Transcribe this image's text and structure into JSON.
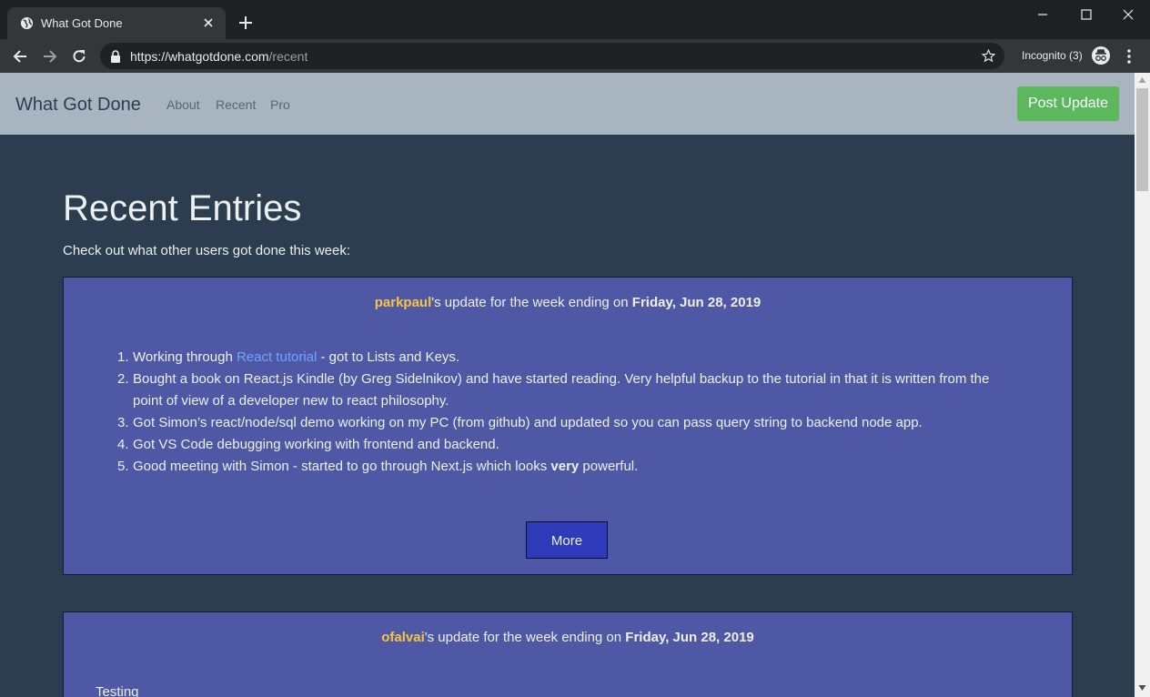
{
  "browser": {
    "tab_title": "What Got Done",
    "url_host": "https://whatgotdone.com",
    "url_path": "/recent",
    "incognito_label": "Incognito (3)"
  },
  "site": {
    "brand": "What Got Done",
    "nav": [
      "About",
      "Recent",
      "Pro"
    ],
    "post_button": "Post Update"
  },
  "page": {
    "title": "Recent Entries",
    "subtitle": "Check out what other users got done this week:"
  },
  "entries": [
    {
      "username": "parkpaul",
      "header_mid": "'s update for the week ending on ",
      "date": "Friday, Jun 28, 2019",
      "items": [
        {
          "num": "1.",
          "pre": "Working through ",
          "link": "React tutorial",
          "post": " - got to Lists and Keys."
        },
        {
          "num": "2.",
          "line1": "Bought a book on React.js Kindle (by Greg Sidelnikov) and have started reading. Very helpful backup to the tutorial in that it is written from the",
          "line2": "point of view of a developer new to react philosophy."
        },
        {
          "num": "3.",
          "text": "Got Simon’s react/node/sql demo working on my PC (from github) and updated so you can pass query string to backend node app."
        },
        {
          "num": "4.",
          "text": "Got VS Code debugging working with frontend and backend."
        },
        {
          "num": "5.",
          "pre": "Good meeting with Simon - started to go through Next.js which looks ",
          "bold": "very",
          "post": " powerful."
        }
      ],
      "more_button": "More"
    },
    {
      "username": "ofalvai",
      "header_mid": "'s update for the week ending on ",
      "date": "Friday, Jun 28, 2019",
      "text": "Testing"
    }
  ],
  "colors": {
    "page_bg": "#2b3d4f",
    "navbar_bg": "#a8b5c1",
    "card_bg": "#4f58a4",
    "username": "#f6c344",
    "link": "#6fa3ff",
    "post_button": "#5cb85c",
    "more_button": "#2d3aba"
  }
}
